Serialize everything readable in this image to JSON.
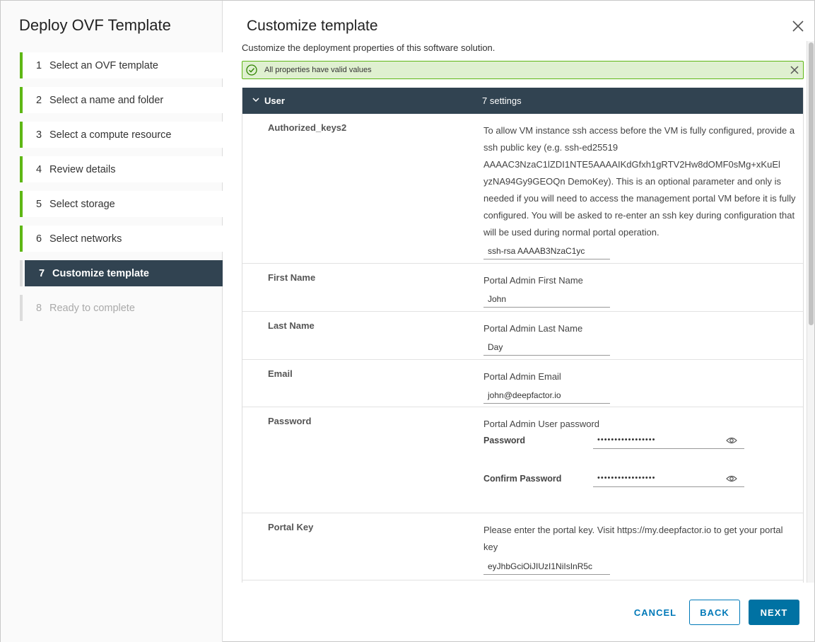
{
  "wizard": {
    "title": "Deploy OVF Template",
    "steps": [
      {
        "num": "1",
        "label": "Select an OVF template"
      },
      {
        "num": "2",
        "label": "Select a name and folder"
      },
      {
        "num": "3",
        "label": "Select a compute resource"
      },
      {
        "num": "4",
        "label": "Review details"
      },
      {
        "num": "5",
        "label": "Select storage"
      },
      {
        "num": "6",
        "label": "Select networks"
      },
      {
        "num": "7",
        "label": "Customize template"
      },
      {
        "num": "8",
        "label": "Ready to complete"
      }
    ]
  },
  "main": {
    "title": "Customize template",
    "subtitle": "Customize the deployment properties of this software solution.",
    "alert": "All properties have valid values",
    "group": {
      "name": "User",
      "count": "7 settings"
    },
    "rows": {
      "authorized_keys": {
        "label": "Authorized_keys2",
        "description": "To allow VM instance ssh access before the VM is fully configured, provide a ssh public key (e.g. ssh-ed25519 AAAAC3NzaC1lZDI1NTE5AAAAIKdGfxh1gRTV2Hw8dOMF0sMg+xKuEl yzNA94Gy9GEOQn DemoKey). This is an optional parameter and only is needed if you will need to access the management portal VM before it is fully configured. You will be asked to re-enter an ssh key during configuration that will be used during normal portal operation.",
        "value": "ssh-rsa AAAAB3NzaC1yc"
      },
      "first_name": {
        "label": "First Name",
        "description": "Portal Admin First Name",
        "value": "John"
      },
      "last_name": {
        "label": "Last Name",
        "description": "Portal Admin Last Name",
        "value": "Day"
      },
      "email": {
        "label": "Email",
        "description": "Portal Admin Email",
        "value": "john@deepfactor.io"
      },
      "password": {
        "label": "Password",
        "description": "Portal Admin User password",
        "pw_label": "Password",
        "pw_value": "•••••••••••••••••",
        "confirm_label": "Confirm Password",
        "confirm_value": "•••••••••••••••••"
      },
      "portal_key": {
        "label": "Portal Key",
        "description": "Please enter the portal key. Visit https://my.deepfactor.io to get your portal key",
        "value": "eyJhbGciOiJIUzI1NiIsInR5c"
      }
    }
  },
  "footer": {
    "cancel": "CANCEL",
    "back": "BACK",
    "next": "NEXT"
  },
  "colors": {
    "accent": "#0079b8",
    "header_bg": "#314351",
    "success": "#5eb715"
  }
}
